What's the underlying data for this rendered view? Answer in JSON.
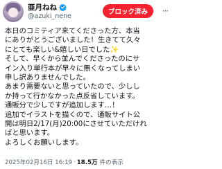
{
  "header": {
    "display_name": "亜月ねね",
    "handle": "@azuki_nene",
    "block_label": "ブロック済み",
    "more_label": "···",
    "verified_color": "#1d9bf0",
    "block_color": "#f4212e"
  },
  "tweet": {
    "lines": [
      "本日のコミティア来てくださった方、本当",
      "にありがとうございました！生きてて久々",
      "にとても楽しい&嬉しい日でした✨",
      "そして、早くから並んでくださったのにサ",
      "イン入り単行本が早々に無くなってしまい",
      "申し訳ありませんでした。",
      "あまり需要ないと思っていたので、少しし",
      "か持って行かなかった点反省しています。",
      "通販分で少しですが追加します…！",
      "追加でイラストを描くので、通販サイト公",
      "開は明日2/17(月)20:00にさせていただけれ",
      "ばと思います。",
      "よろしくお願いします。"
    ]
  },
  "meta": {
    "timestamp": "2025年02月16日 16:19",
    "dot": "·",
    "views_count": "18.5万",
    "views_label": "件の表示"
  }
}
